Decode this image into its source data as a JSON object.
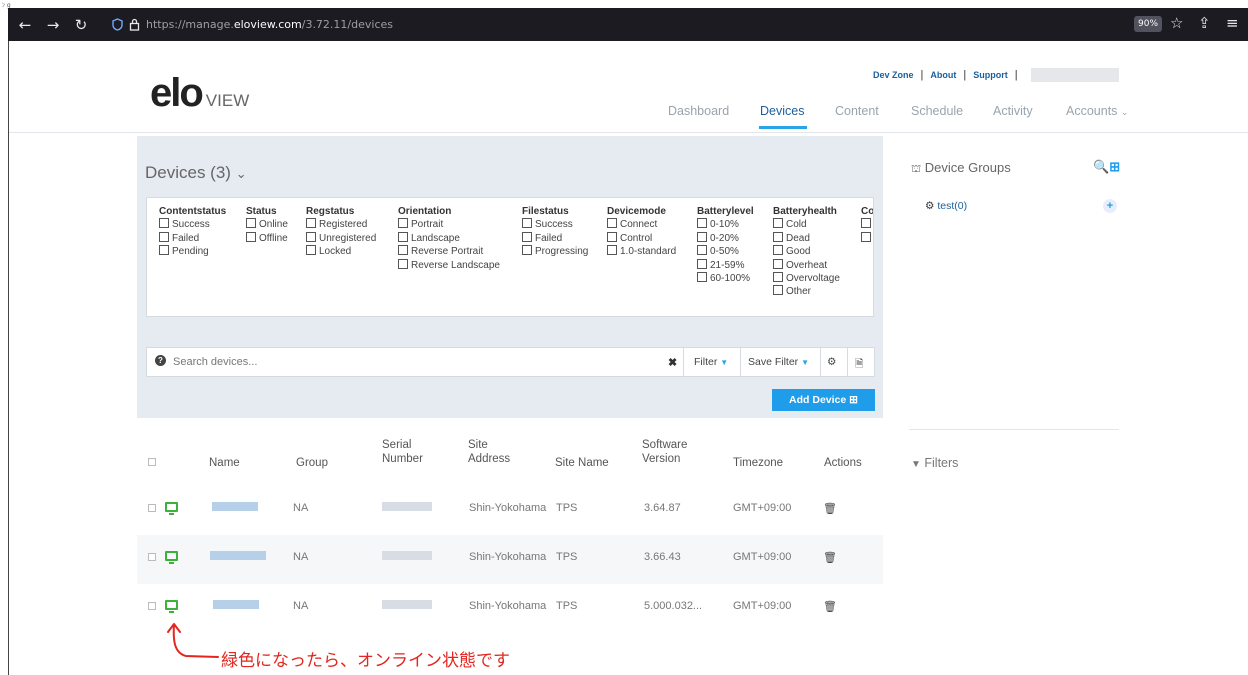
{
  "browser": {
    "corner_mark": "ﾝ g",
    "url_prefix": "https://manage.",
    "url_domain": "eloview.com",
    "url_path": "/3.72.11/devices",
    "zoom": "90%"
  },
  "header": {
    "logo_main": "elo",
    "logo_sub": "VIEW",
    "links": [
      "Dev Zone",
      "About",
      "Support"
    ],
    "nav": [
      "Dashboard",
      "Devices",
      "Content",
      "Schedule",
      "Activity",
      "Accounts"
    ],
    "active_nav": "Devices"
  },
  "devices": {
    "title": "Devices (3)",
    "filters": [
      {
        "heading": "Contentstatus",
        "items": [
          "Success",
          "Failed",
          "Pending"
        ]
      },
      {
        "heading": "Status",
        "items": [
          "Online",
          "Offline"
        ]
      },
      {
        "heading": "Regstatus",
        "items": [
          "Registered",
          "Unregistered",
          "Locked"
        ]
      },
      {
        "heading": "Orientation",
        "items": [
          "Portrait",
          "Landscape",
          "Reverse Portrait",
          "Reverse Landscape"
        ]
      },
      {
        "heading": "Filestatus",
        "items": [
          "Success",
          "Failed",
          "Progressing"
        ]
      },
      {
        "heading": "Devicemode",
        "items": [
          "Connect",
          "Control",
          "1.0-standard"
        ]
      },
      {
        "heading": "Batterylevel",
        "items": [
          "0-10%",
          "0-20%",
          "0-50%",
          "21-59%",
          "60-100%"
        ]
      },
      {
        "heading": "Batteryhealth",
        "items": [
          "Cold",
          "Dead",
          "Good",
          "Overheat",
          "Overvoltage",
          "Other"
        ]
      },
      {
        "heading": "Co",
        "items": [
          "",
          ""
        ]
      }
    ],
    "search_placeholder": "Search devices...",
    "filter_label": "Filter",
    "save_filter_label": "Save Filter",
    "add_device_label": "Add Device",
    "columns": {
      "name": "Name",
      "group": "Group",
      "serial_1": "Serial",
      "serial_2": "Number",
      "site_1": "Site",
      "site_2": "Address",
      "site_name": "Site Name",
      "sw_1": "Software",
      "sw_2": "Version",
      "timezone": "Timezone",
      "actions": "Actions"
    },
    "rows": [
      {
        "group": "NA",
        "site_address": "Shin-Yokohama",
        "site_name": "TPS",
        "version": "3.64.87",
        "timezone": "GMT+09:00"
      },
      {
        "group": "NA",
        "site_address": "Shin-Yokohama",
        "site_name": "TPS",
        "version": "3.66.43",
        "timezone": "GMT+09:00"
      },
      {
        "group": "NA",
        "site_address": "Shin-Yokohama",
        "site_name": "TPS",
        "version": "5.000.032...",
        "timezone": "GMT+09:00"
      }
    ]
  },
  "sidebar": {
    "groups_title": "Device Groups",
    "group_item": "test(0)",
    "filters_title": "Filters"
  },
  "annotation": {
    "text": "緑色になったら、オンライン状態です",
    "color": "#e3261f"
  },
  "colors": {
    "accent": "#1f9cea",
    "online": "#3cb23c"
  }
}
